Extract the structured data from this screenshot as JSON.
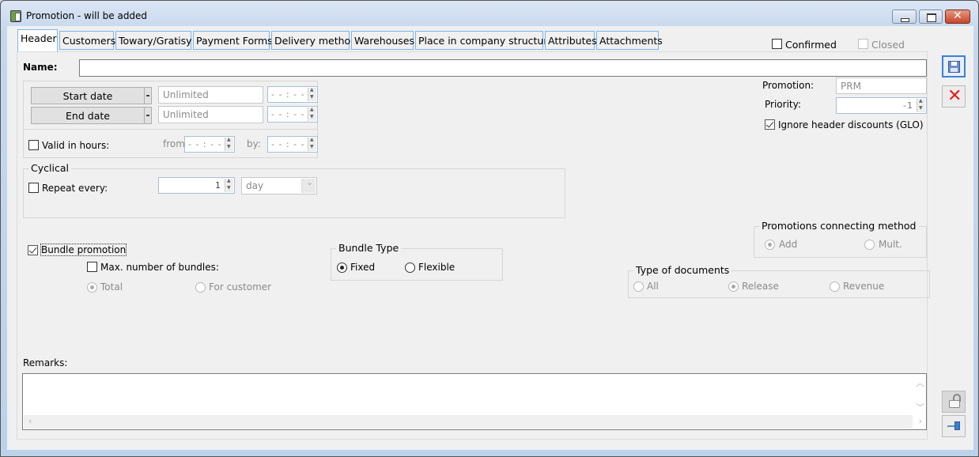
{
  "window": {
    "title": "Promotion - will be added",
    "controls": {
      "minimize": "minimize",
      "maximize": "maximize",
      "close": "✕"
    }
  },
  "tabs": [
    {
      "label": "Header",
      "active": true
    },
    {
      "label": "Customers",
      "active": false
    },
    {
      "label": "Towary/Gratisy",
      "active": false
    },
    {
      "label": "Payment Forms",
      "active": false
    },
    {
      "label": "Delivery method",
      "active": false
    },
    {
      "label": "Warehouses",
      "active": false
    },
    {
      "label": "Place in company structure",
      "active": false
    },
    {
      "label": "Attributes",
      "active": false
    },
    {
      "label": "Attachments",
      "active": false
    }
  ],
  "status": {
    "confirmed_label": "Confirmed",
    "confirmed_checked": false,
    "closed_label": "Closed",
    "closed_checked": false
  },
  "header": {
    "name_label": "Name:",
    "name_value": "",
    "start_date_label": "Start date",
    "start_date_value": "Unlimited",
    "start_time_value": "- - : - -",
    "end_date_label": "End date",
    "end_date_value": "Unlimited",
    "end_time_value": "- - : - -",
    "valid_hours_label": "Valid in hours:",
    "valid_hours_checked": false,
    "from_label": "from",
    "from_value": "- - : - -",
    "by_label": "by:",
    "by_value": "- - : - -"
  },
  "cyclical": {
    "title": "Cyclical",
    "repeat_label": "Repeat every:",
    "repeat_checked": false,
    "repeat_value": "1",
    "unit_value": "day"
  },
  "promotion_info": {
    "promotion_label": "Promotion:",
    "promotion_value": "PRM",
    "priority_label": "Priority:",
    "priority_value": "-1",
    "ignore_glo_label": "Ignore header discounts (GLO)",
    "ignore_glo_checked": true
  },
  "connecting_method": {
    "title": "Promotions connecting method",
    "options": [
      {
        "label": "Add",
        "selected": true
      },
      {
        "label": "Mult.",
        "selected": false
      }
    ]
  },
  "bundle": {
    "bundle_label": "Bundle promotion",
    "bundle_checked": true,
    "max_bundles_label": "Max. number of bundles:",
    "max_bundles_checked": false,
    "scope_options": [
      {
        "label": "Total",
        "selected": true
      },
      {
        "label": "For customer",
        "selected": false
      }
    ],
    "type_title": "Bundle Type",
    "type_options": [
      {
        "label": "Fixed",
        "selected": true
      },
      {
        "label": "Flexible",
        "selected": false
      }
    ]
  },
  "document_types": {
    "title": "Type of documents",
    "options": [
      {
        "label": "All",
        "selected": false
      },
      {
        "label": "Release",
        "selected": true
      },
      {
        "label": "Revenue",
        "selected": false
      }
    ]
  },
  "remarks": {
    "label": "Remarks:",
    "value": ""
  },
  "side_buttons": {
    "save": "save-icon",
    "cancel": "close-icon",
    "lock": "unlock-icon",
    "pin": "pin-icon"
  }
}
